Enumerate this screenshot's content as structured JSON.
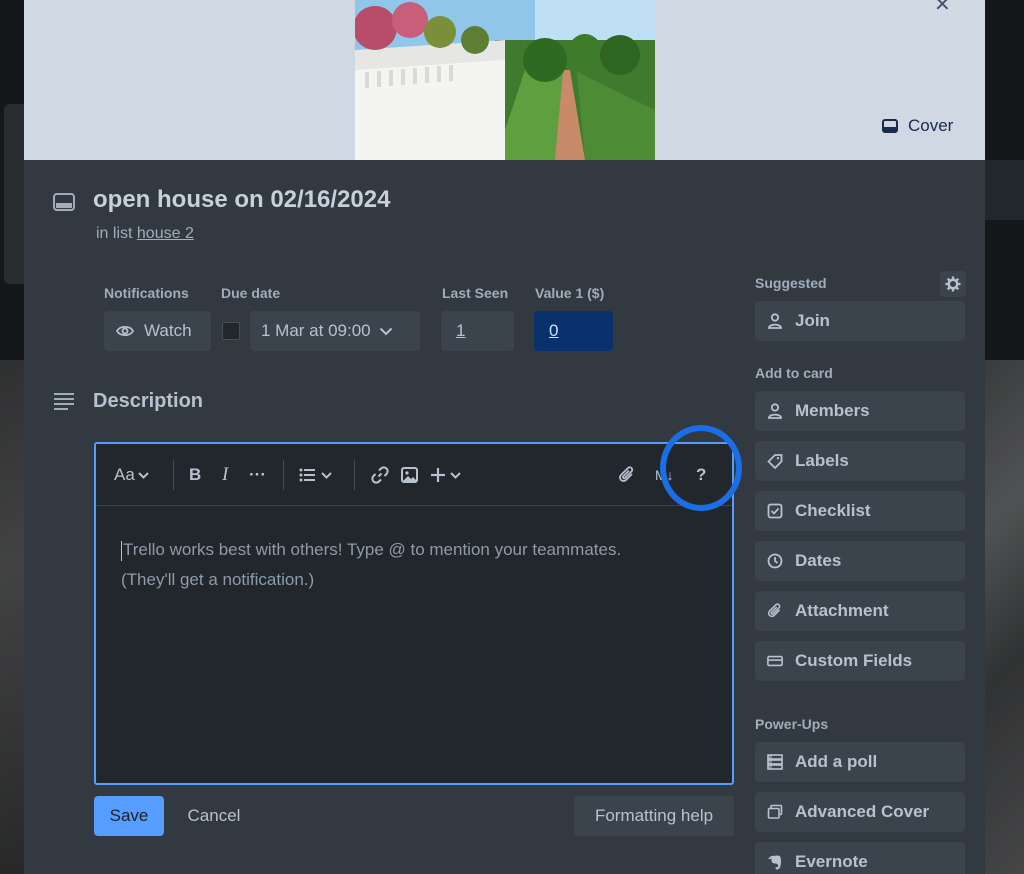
{
  "card": {
    "title": "open house on 02/16/2024",
    "in_list_prefix": "in list",
    "list_name": "house 2",
    "cover_label": "Cover"
  },
  "fields": {
    "notifications_label": "Notifications",
    "watch_label": "Watch",
    "due_date_label": "Due date",
    "due_date_value": "1 Mar at 09:00",
    "last_seen_label": "Last Seen",
    "last_seen_value": "1",
    "value1_label": "Value 1 ($)",
    "value1_value": "0"
  },
  "description": {
    "title": "Description",
    "placeholder_line1": "Trello works best with others! Type @ to mention your teammates.",
    "placeholder_line2": "(They'll get a notification.)",
    "toolbar": {
      "text_style": "Aa",
      "help": "?"
    },
    "save_label": "Save",
    "cancel_label": "Cancel",
    "formatting_help_label": "Formatting help"
  },
  "sidebar": {
    "suggested_label": "Suggested",
    "suggested": [
      {
        "label": "Join",
        "icon": "person-icon"
      }
    ],
    "add_to_card_label": "Add to card",
    "add_to_card": [
      {
        "label": "Members",
        "icon": "person-icon"
      },
      {
        "label": "Labels",
        "icon": "tag-icon"
      },
      {
        "label": "Checklist",
        "icon": "checkbox-icon"
      },
      {
        "label": "Dates",
        "icon": "clock-icon"
      },
      {
        "label": "Attachment",
        "icon": "paperclip-icon"
      },
      {
        "label": "Custom Fields",
        "icon": "custom-fields-icon"
      }
    ],
    "power_ups_label": "Power-Ups",
    "power_ups": [
      {
        "label": "Add a poll",
        "icon": "poll-icon"
      },
      {
        "label": "Advanced Cover",
        "icon": "cover-icon"
      },
      {
        "label": "Evernote",
        "icon": "evernote-icon"
      }
    ]
  },
  "colors": {
    "accent": "#579dff",
    "highlight_ring": "#1a6ee6",
    "modal_bg": "#323940",
    "button_bg": "#3b444c",
    "value_field_bg": "#09326c"
  }
}
